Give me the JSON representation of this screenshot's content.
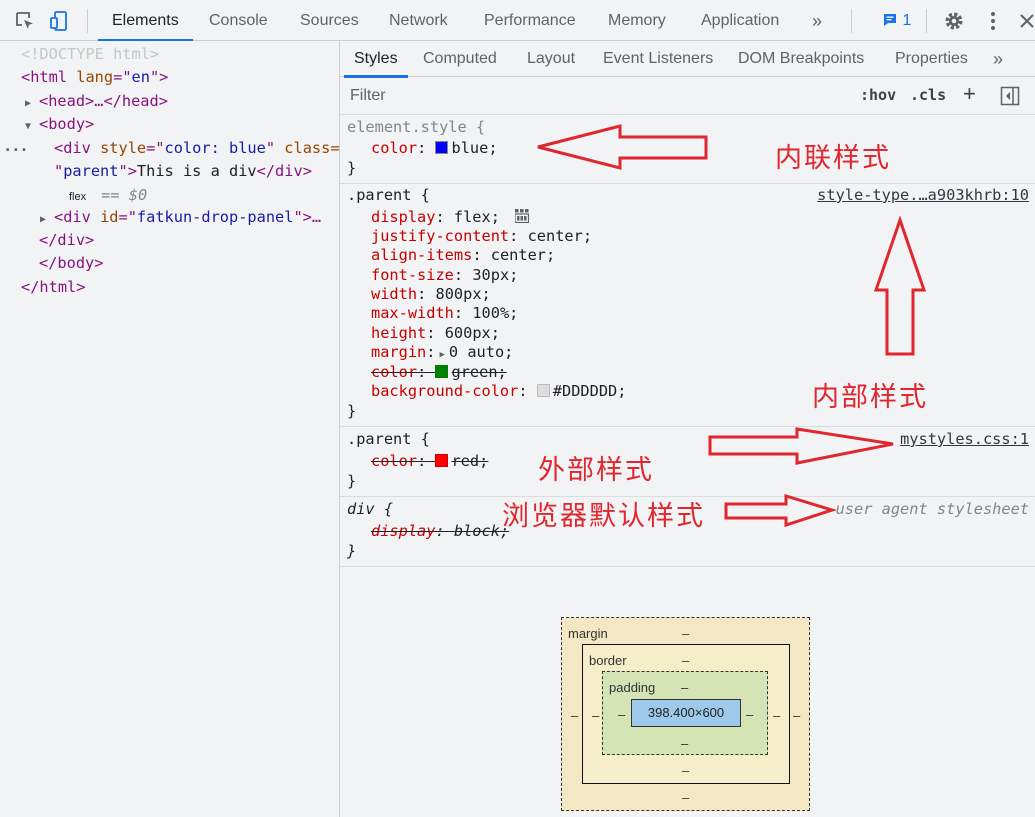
{
  "toolbar": {
    "tabs": [
      "Elements",
      "Console",
      "Sources",
      "Network",
      "Performance",
      "Memory",
      "Application"
    ],
    "more": "»",
    "issues_count": "1",
    "inspect_icon": "inspect-cursor-icon",
    "device_icon": "device-toggle-icon",
    "settings_icon": "gear-icon",
    "menu_icon": "kebab-menu-icon",
    "close_icon": "close-icon"
  },
  "dom_tree": {
    "doctype": "<!DOCTYPE html>",
    "html_open": "<html lang=\"en\">",
    "head": "<head>…</head>",
    "body_open": "<body>",
    "div_attr_style": "style",
    "div_attr_style_val": "color: blue",
    "div_attr_class": "class=",
    "div_class_val": "parent",
    "div_text": "This is a div",
    "div_close": "</div>",
    "flex_badge": "flex",
    "eq_dollar0": "== $0",
    "drop_panel": "<div id=\"fatkun-drop-panel\">…",
    "div_close2": "</div>",
    "body_close": "</body>",
    "html_close": "</html>",
    "ellipsis": "..."
  },
  "styles": {
    "subtabs": [
      "Styles",
      "Computed",
      "Layout",
      "Event Listeners",
      "DOM Breakpoints",
      "Properties"
    ],
    "more": "»",
    "filter_placeholder": "Filter",
    "hov": ":hov",
    "cls": ".cls",
    "plus": "+",
    "sidebar_icon": "toggle-sidebar-icon",
    "rules": {
      "element_style": {
        "selector": "element.style {",
        "props": [
          {
            "name": "color",
            "value": "blue;",
            "swatch": "#0000ff"
          }
        ],
        "close": "}"
      },
      "parent_internal": {
        "selector": ".parent {",
        "source": "style-type.…a903khrb:10",
        "props": [
          {
            "name": "display",
            "value": "flex;"
          },
          {
            "name": "justify-content",
            "value": "center;"
          },
          {
            "name": "align-items",
            "value": "center;"
          },
          {
            "name": "font-size",
            "value": "30px;"
          },
          {
            "name": "width",
            "value": "800px;"
          },
          {
            "name": "max-width",
            "value": "100%;"
          },
          {
            "name": "height",
            "value": "600px;"
          },
          {
            "name": "margin",
            "value": "0 auto;"
          },
          {
            "name": "color",
            "value": "green;",
            "swatch": "#008000"
          },
          {
            "name": "background-color",
            "value": "#DDDDDD;",
            "swatch": "#dddddd"
          }
        ],
        "close": "}"
      },
      "parent_external": {
        "selector": ".parent {",
        "source": "mystyles.css:1",
        "props": [
          {
            "name": "color",
            "value": "red;",
            "swatch": "#ff0000"
          }
        ],
        "close": "}"
      },
      "div_ua": {
        "selector": "div {",
        "source": "user agent stylesheet",
        "props": [
          {
            "name": "display",
            "value": "block;"
          }
        ],
        "close": "}"
      }
    }
  },
  "box_model": {
    "margin_label": "margin",
    "border_label": "border",
    "padding_label": "padding",
    "content_size": "398.400×600",
    "dash": "–"
  },
  "annotations": {
    "inline": "内联样式",
    "internal": "内部样式",
    "external": "外部样式",
    "browser_default": "浏览器默认样式",
    "color": "#e0262e"
  }
}
